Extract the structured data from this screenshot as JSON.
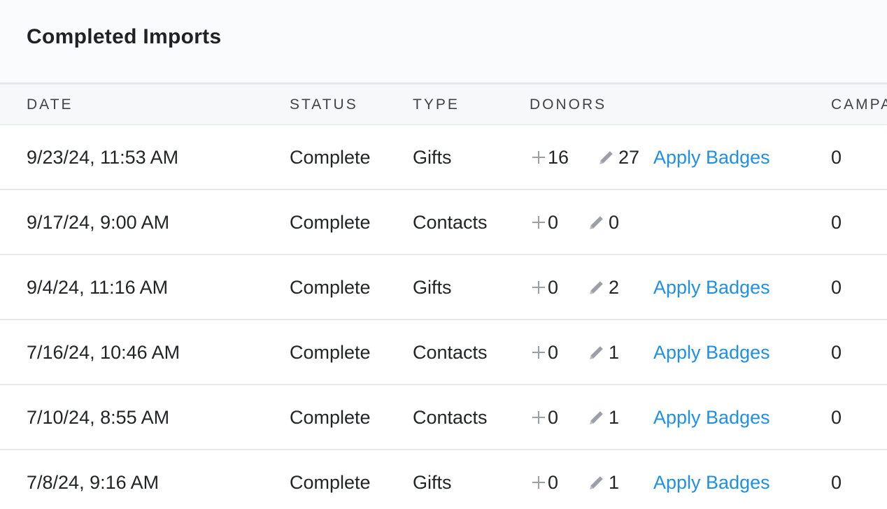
{
  "title": "Completed Imports",
  "columns": {
    "date": "DATE",
    "status": "STATUS",
    "type": "TYPE",
    "donors": "DONORS",
    "campaigns": "CAMPA"
  },
  "rows": [
    {
      "date": "9/23/24, 11:53 AM",
      "status": "Complete",
      "type": "Gifts",
      "new": "16",
      "updated": "27",
      "link": "Apply Badges",
      "campaigns": "0"
    },
    {
      "date": "9/17/24, 9:00 AM",
      "status": "Complete",
      "type": "Contacts",
      "new": "0",
      "updated": "0",
      "link": "",
      "campaigns": "0"
    },
    {
      "date": "9/4/24, 11:16 AM",
      "status": "Complete",
      "type": "Gifts",
      "new": "0",
      "updated": "2",
      "link": "Apply Badges",
      "campaigns": "0"
    },
    {
      "date": "7/16/24, 10:46 AM",
      "status": "Complete",
      "type": "Contacts",
      "new": "0",
      "updated": "1",
      "link": "Apply Badges",
      "campaigns": "0"
    },
    {
      "date": "7/10/24, 8:55 AM",
      "status": "Complete",
      "type": "Contacts",
      "new": "0",
      "updated": "1",
      "link": "Apply Badges",
      "campaigns": "0"
    },
    {
      "date": "7/8/24, 9:16 AM",
      "status": "Complete",
      "type": "Gifts",
      "new": "0",
      "updated": "1",
      "link": "Apply Badges",
      "campaigns": "0"
    }
  ],
  "icons": {
    "added": "plus-icon",
    "updated": "pencil-icon"
  },
  "colors": {
    "link": "#1e90e6",
    "icon": "#9aa0a6"
  }
}
